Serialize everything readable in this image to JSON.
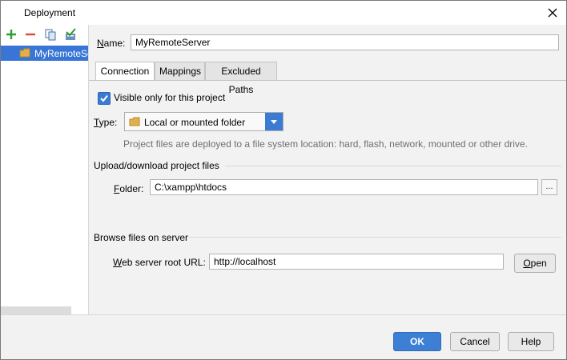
{
  "window": {
    "title": "Deployment"
  },
  "toolbar": {
    "icons": [
      "add-icon",
      "remove-icon",
      "copy-icon",
      "set-default-icon"
    ],
    "colors": {
      "add": "#2e9e2e",
      "remove": "#d64a3a",
      "copy": "#4a6fa5"
    }
  },
  "tree": {
    "items": [
      {
        "label": "MyRemoteServer",
        "selected": true
      }
    ]
  },
  "form": {
    "name_label_prefix": "",
    "name_label_mnemonic": "N",
    "name_label_rest": "ame:",
    "name_value": "MyRemoteServer"
  },
  "tabs": [
    {
      "label": "Connection",
      "active": true
    },
    {
      "label": "Mappings",
      "active": false
    },
    {
      "label": "Excluded Paths",
      "active": false
    }
  ],
  "connection": {
    "visible_only_label": "Visible only for this project",
    "visible_only_checked": true,
    "type_label_mnemonic": "T",
    "type_label_rest": "ype:",
    "type_value": "Local or mounted folder",
    "type_hint": "Project files are deployed to a file system location: hard, flash, network, mounted or other drive.",
    "upload_section": "Upload/download project files",
    "folder_label_mnemonic": "F",
    "folder_label_rest": "older:",
    "folder_value": "C:\\xampp\\htdocs",
    "browse_label": "...",
    "browse_section": "Browse files on server",
    "web_root_label_mnemonic": "W",
    "web_root_label_rest": "eb server root URL:",
    "web_root_value": "http://localhost",
    "open_label_mnemonic": "O",
    "open_label_rest": "pen"
  },
  "buttons": {
    "ok": "OK",
    "cancel": "Cancel",
    "help": "Help"
  },
  "colors": {
    "accent": "#3c7fd5",
    "selection": "#3875d7",
    "hint": "#6f6f6f"
  }
}
